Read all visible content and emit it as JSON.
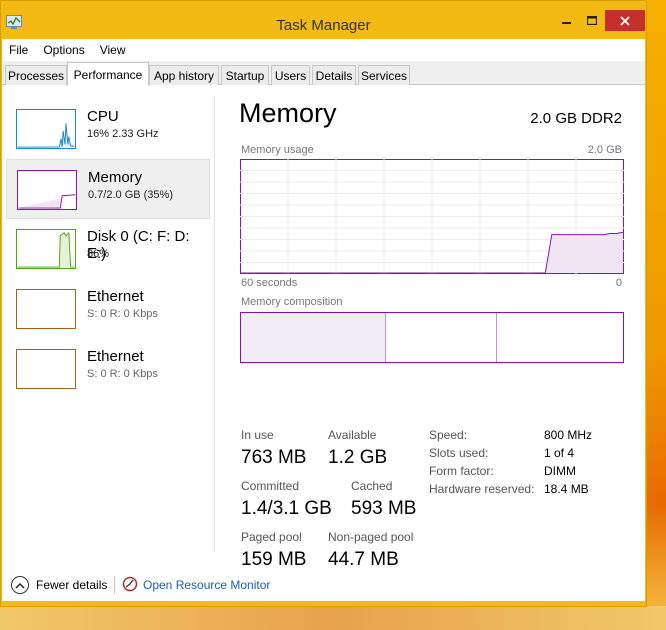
{
  "window": {
    "title": "Task Manager"
  },
  "menu": [
    "File",
    "Options",
    "View"
  ],
  "tabs": [
    "Processes",
    "Performance",
    "App history",
    "Startup",
    "Users",
    "Details",
    "Services"
  ],
  "sidebar": [
    {
      "title": "CPU",
      "sub": "16%  2.33 GHz"
    },
    {
      "title": "Memory",
      "sub": "0.7/2.0 GB (35%)"
    },
    {
      "title": "Disk 0 (C: F: D: E:)",
      "sub": "86%"
    },
    {
      "title": "Ethernet",
      "sub": "S: 0 R: 0 Kbps"
    },
    {
      "title": "Ethernet",
      "sub": "S: 0 R: 0 Kbps"
    }
  ],
  "main": {
    "title": "Memory",
    "spec": "2.0 GB DDR2",
    "usage_label": "Memory usage",
    "usage_max": "2.0 GB",
    "axis_left": "60 seconds",
    "axis_right": "0",
    "composition_label": "Memory composition",
    "composition_fractions": [
      0.38,
      0.29,
      0.33
    ],
    "usage_series_pct": [
      0,
      0,
      0,
      0,
      0,
      0,
      0,
      0,
      0,
      0,
      0,
      0,
      0,
      0,
      0,
      0,
      0,
      0,
      0,
      0,
      0,
      0,
      0,
      0,
      0,
      0,
      0,
      0,
      0,
      0,
      0,
      0,
      0,
      0,
      0,
      0,
      0,
      0,
      0,
      0,
      0,
      0,
      0,
      0,
      0,
      0,
      0,
      0,
      34,
      34,
      34,
      34,
      34,
      34,
      34,
      34,
      34,
      35,
      35,
      36
    ]
  },
  "stats": {
    "in_use_label": "In use",
    "in_use_value": "763 MB",
    "available_label": "Available",
    "available_value": "1.2 GB",
    "committed_label": "Committed",
    "committed_value": "1.4/3.1 GB",
    "cached_label": "Cached",
    "cached_value": "593 MB",
    "paged_label": "Paged pool",
    "paged_value": "159 MB",
    "nonpaged_label": "Non-paged pool",
    "nonpaged_value": "44.7 MB"
  },
  "specs": {
    "speed_label": "Speed:",
    "speed_value": "800 MHz",
    "slots_label": "Slots used:",
    "slots_value": "1 of 4",
    "form_label": "Form factor:",
    "form_value": "DIMM",
    "hw_label": "Hardware reserved:",
    "hw_value": "18.4 MB"
  },
  "footer": {
    "fewer_details": "Fewer details",
    "resource_monitor": "Open Resource Monitor"
  },
  "colors": {
    "cpu": "#1a86c9",
    "memory": "#8b12ae",
    "disk": "#4da60c",
    "ethernet": "#a75f1b",
    "close": "#c7302a"
  },
  "icons": {
    "app": "task-manager-icon",
    "fewer": "chevron-up-icon",
    "resmon": "resource-monitor-icon"
  }
}
